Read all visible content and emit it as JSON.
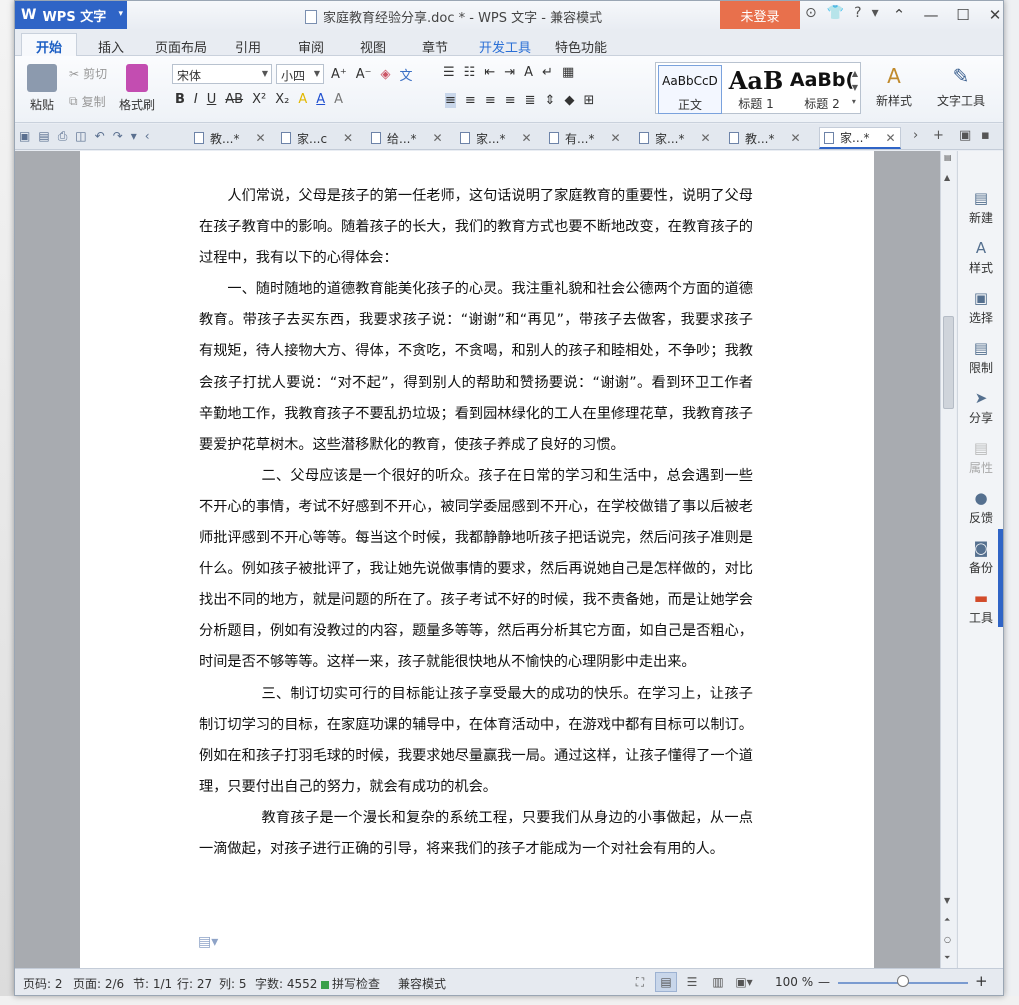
{
  "app": {
    "badge": "WPS 文字",
    "badge_caret": "▾",
    "doc_title": "家庭教育经验分享.doc * - WPS 文字 - 兼容模式",
    "login": "未登录"
  },
  "title_icons": [
    "⊙",
    "👕",
    "?",
    "▾"
  ],
  "win_ctrls": {
    "collapse": "⌃",
    "minimize": "—",
    "maximize": "☐",
    "close": "✕"
  },
  "tabs": [
    "开始",
    "插入",
    "页面布局",
    "引用",
    "审阅",
    "视图",
    "章节",
    "开发工具",
    "特色功能"
  ],
  "ribbon": {
    "paste": "粘贴",
    "cut": "剪切",
    "copy": "复制",
    "format_painter": "格式刷",
    "font_name": "宋体",
    "font_size": "小四",
    "styles": [
      {
        "sample": "AaBbCcD",
        "name": "正文"
      },
      {
        "sample": "AaB",
        "name": "标题 1"
      },
      {
        "sample": "AaBb(",
        "name": "标题 2"
      }
    ],
    "new_style": "新样式",
    "text_tools": "文字工具",
    "font_buttons": [
      "B",
      "I",
      "U",
      "AB",
      "X²",
      "X₂"
    ],
    "size_buttons": [
      "A⁺",
      "A⁻"
    ]
  },
  "doc_tabs": [
    {
      "label": "教...*"
    },
    {
      "label": "家...c"
    },
    {
      "label": "给...*"
    },
    {
      "label": "家...*"
    },
    {
      "label": "有...*"
    },
    {
      "label": "家...*"
    },
    {
      "label": "教...*"
    },
    {
      "label": "家...*"
    }
  ],
  "document": {
    "p1": "人们常说，父母是孩子的第一任老师，这句话说明了家庭教育的重要性，说明了父母在孩子教育中的影响。随着孩子的长大，我们的教育方式也要不断地改变，在教育孩子的过程中，我有以下的心得体会：",
    "p2": "一、随时随地的道德教育能美化孩子的心灵。我注重礼貌和社会公德两个方面的道德教育。带孩子去买东西，我要求孩子说：“谢谢”和“再见”，带孩子去做客，我要求孩子有规矩，待人接物大方、得体，不贪吃，不贪喝，和别人的孩子和睦相处，不争吵；我教会孩子打扰人要说：“对不起”，得到别人的帮助和赞扬要说：“谢谢”。看到环卫工作者辛勤地工作，我教育孩子不要乱扔垃圾；看到园林绿化的工人在里修理花草，我教育孩子要爱护花草树木。这些潜移默化的教育，使孩子养成了良好的习惯。",
    "p3": "二、父母应该是一个很好的听众。孩子在日常的学习和生活中，总会遇到一些不开心的事情，考试不好感到不开心，被同学委屈感到不开心，在学校做错了事以后被老师批评感到不开心等等。每当这个时候，我都静静地听孩子把话说完，然后问孩子准则是什么。例如孩子被批评了，我让她先说做事情的要求，然后再说她自己是怎样做的，对比找出不同的地方，就是问题的所在了。孩子考试不好的时候，我不责备她，而是让她学会分析题目，例如有没教过的内容，题量多等等，然后再分析其它方面，如自己是否粗心，时间是否不够等等。这样一来，孩子就能很快地从不愉快的心理阴影中走出来。",
    "p4": "三、制订切实可行的目标能让孩子享受最大的成功的快乐。在学习上，让孩子制订切学习的目标，在家庭功课的辅导中，在体育活动中，在游戏中都有目标可以制订。例如在和孩子打羽毛球的时候，我要求她尽量赢我一局。通过这样，让孩子懂得了一个道理，只要付出自己的努力，就会有成功的机会。",
    "p5": "教育孩子是一个漫长和复杂的系统工程，只要我们从身边的小事做起，从一点一滴做起，对孩子进行正确的引导，将来我们的孩子才能成为一个对社会有用的人。"
  },
  "task_pane": [
    "新建",
    "样式",
    "选择",
    "限制",
    "分享",
    "属性",
    "反馈",
    "备份",
    "工具"
  ],
  "status": {
    "page_no": "页码: 2",
    "pages": "页面: 2/6",
    "section": "节: 1/1",
    "row": "行: 27",
    "col": "列: 5",
    "words": "字数: 4552",
    "spell": "拼写检查",
    "compat": "兼容模式",
    "zoom": "100 %"
  }
}
